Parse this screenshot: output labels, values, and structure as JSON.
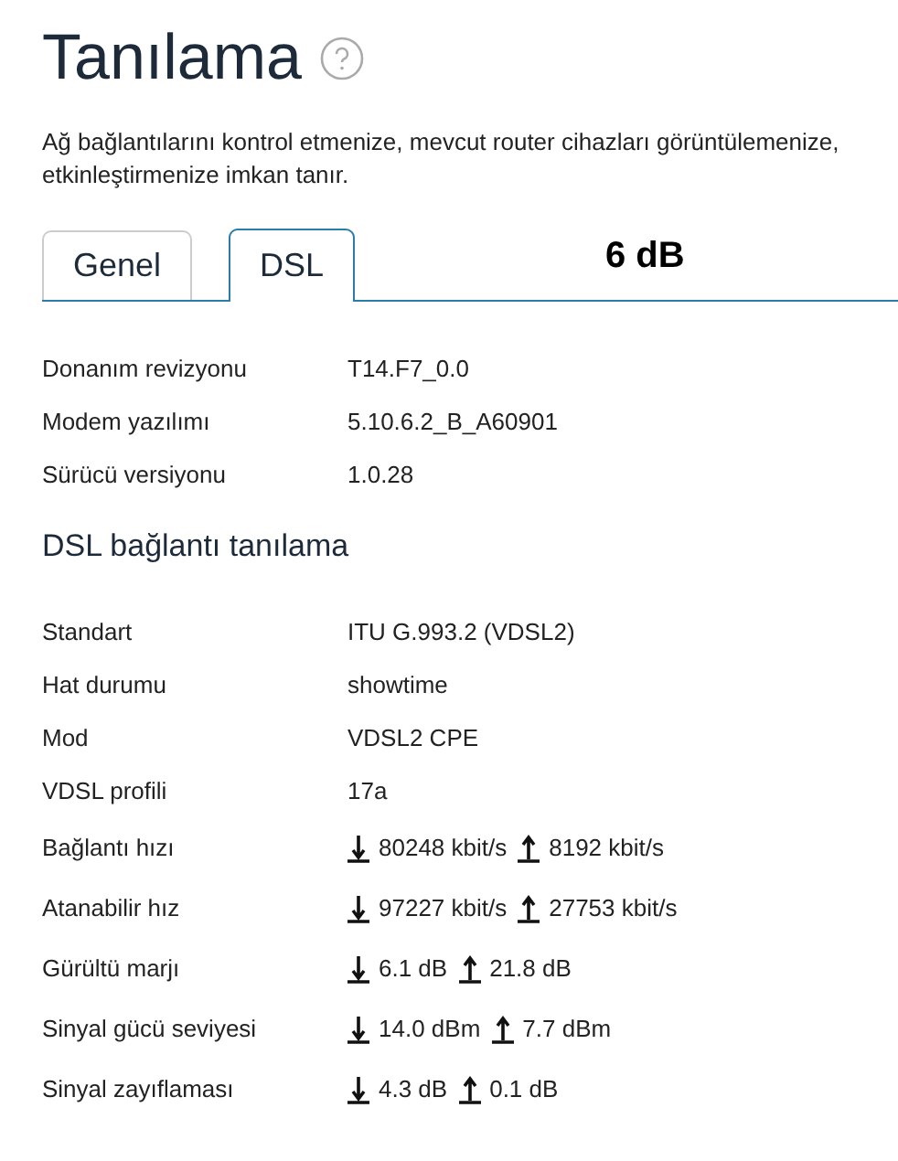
{
  "title": "Tanılama",
  "description": [
    "Ağ bağlantılarını kontrol etmenize, mevcut router cihazları görüntülemenize,",
    "etkinleştirmenize imkan tanır."
  ],
  "tabs": [
    {
      "label": "Genel",
      "selected": false
    },
    {
      "label": "DSL",
      "selected": true
    }
  ],
  "overlay_text": "6 dB",
  "info_rows": [
    {
      "label": "Donanım revizyonu",
      "value": "T14.F7_0.0"
    },
    {
      "label": "Modem yazılımı",
      "value": "5.10.6.2_B_A60901"
    },
    {
      "label": "Sürücü versiyonu",
      "value": "1.0.28"
    }
  ],
  "section_title": "DSL bağlantı tanılama",
  "dsl_rows": [
    {
      "kind": "text",
      "label": "Standart",
      "value": "ITU G.993.2 (VDSL2)"
    },
    {
      "kind": "text",
      "label": "Hat durumu",
      "value": "showtime"
    },
    {
      "kind": "text",
      "label": "Mod",
      "value": "VDSL2 CPE"
    },
    {
      "kind": "text",
      "label": "VDSL profili",
      "value": "17a"
    },
    {
      "kind": "updown",
      "label": "Bağlantı hızı",
      "down": "80248 kbit/s",
      "up": "8192 kbit/s"
    },
    {
      "kind": "updown",
      "label": "Atanabilir hız",
      "down": "97227 kbit/s",
      "up": "27753 kbit/s"
    },
    {
      "kind": "updown",
      "label": "Gürültü marjı",
      "down": "6.1 dB",
      "up": "21.8 dB"
    },
    {
      "kind": "updown",
      "label": "Sinyal gücü seviyesi",
      "down": "14.0 dBm",
      "up": "7.7 dBm"
    },
    {
      "kind": "updown",
      "label": "Sinyal zayıflaması",
      "down": "4.3 dB",
      "up": "0.1 dB"
    }
  ]
}
